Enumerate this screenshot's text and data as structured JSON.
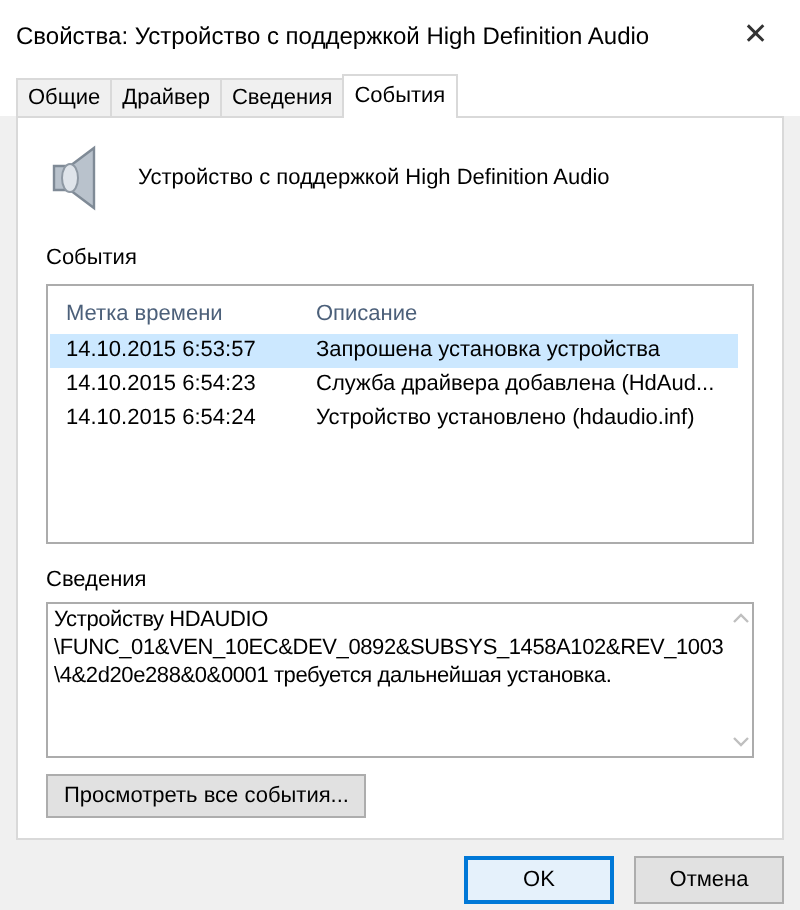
{
  "window": {
    "title": "Свойства: Устройство с поддержкой High Definition Audio",
    "close": "✕"
  },
  "tabs": [
    {
      "label": "Общие",
      "selected": false
    },
    {
      "label": "Драйвер",
      "selected": false
    },
    {
      "label": "Сведения",
      "selected": false
    },
    {
      "label": "События",
      "selected": true
    }
  ],
  "device": {
    "name": "Устройство с поддержкой High Definition Audio"
  },
  "events": {
    "label": "События",
    "columns": [
      "Метка времени",
      "Описание"
    ],
    "rows": [
      {
        "time": "14.10.2015 6:53:57",
        "description": "Запрошена установка устройства",
        "selected": true
      },
      {
        "time": "14.10.2015 6:54:23",
        "description": "Служба драйвера добавлена (HdAud...",
        "selected": false
      },
      {
        "time": "14.10.2015 6:54:24",
        "description": "Устройство установлено (hdaudio.inf)",
        "selected": false
      }
    ]
  },
  "details": {
    "label": "Сведения",
    "text": "Устройству HDAUDIO\n\\FUNC_01&VEN_10EC&DEV_0892&SUBSYS_1458A102&REV_1003\n\\4&2d20e288&0&0001 требуется дальнейшая установка."
  },
  "view_all_button": "Просмотреть все события...",
  "buttons": [
    {
      "label": "OK",
      "default": true
    },
    {
      "label": "Отмена",
      "default": false
    }
  ]
}
